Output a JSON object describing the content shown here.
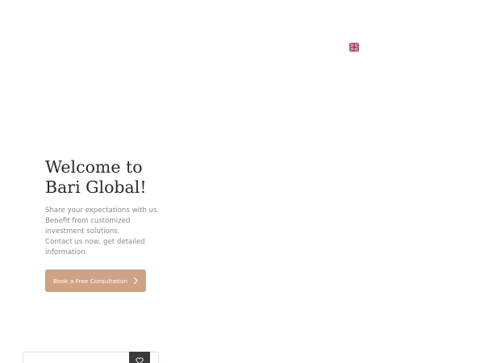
{
  "header": {
    "language_icon": "uk-flag-icon"
  },
  "hero": {
    "title_line1": "Welcome to",
    "title_line2": "Bari Global!",
    "text_lines": [
      "Share your expectations with us.",
      "Benefit from customized",
      "investment solutions.",
      "Contact us now, get detailed",
      "information."
    ],
    "cta_label": "Book a Free Consultation",
    "cta_icon": "chevron-right-icon"
  },
  "search": {
    "placeholder": "",
    "button_icon": "heart-icon"
  },
  "colors": {
    "accent": "#cfa284",
    "title": "#2a2a2a",
    "body_text": "#8a8a8a",
    "search_button": "#3a3a3a"
  }
}
